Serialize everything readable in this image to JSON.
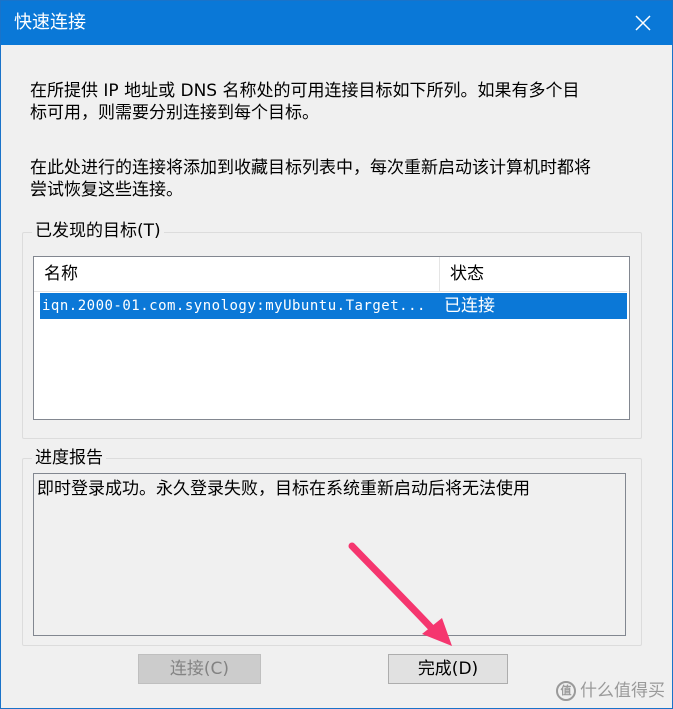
{
  "window": {
    "title": "快速连接"
  },
  "description": {
    "line1": "在所提供 IP 地址或 DNS 名称处的可用连接目标如下所列。如果有多个目\n标可用，则需要分别连接到每个目标。",
    "line2": "在此处进行的连接将添加到收藏目标列表中，每次重新启动该计算机时都将\n尝试恢复这些连接。"
  },
  "targets": {
    "group_label": "已发现的目标(T)",
    "columns": [
      "名称",
      "状态"
    ],
    "rows": [
      {
        "name": "iqn.2000-01.com.synology:myUbuntu.Target...",
        "status": "已连接",
        "selected": true
      }
    ]
  },
  "progress": {
    "group_label": "进度报告",
    "text": "即时登录成功。永久登录失败，目标在系统重新启动后将无法使用"
  },
  "buttons": {
    "connect": "连接(C)",
    "done": "完成(D)"
  },
  "watermark": {
    "text": "什么值得买",
    "logo": "值"
  },
  "colors": {
    "titlebar": "#0a78d7",
    "selection": "#0b78d7",
    "annotation_arrow": "#f5366f"
  }
}
